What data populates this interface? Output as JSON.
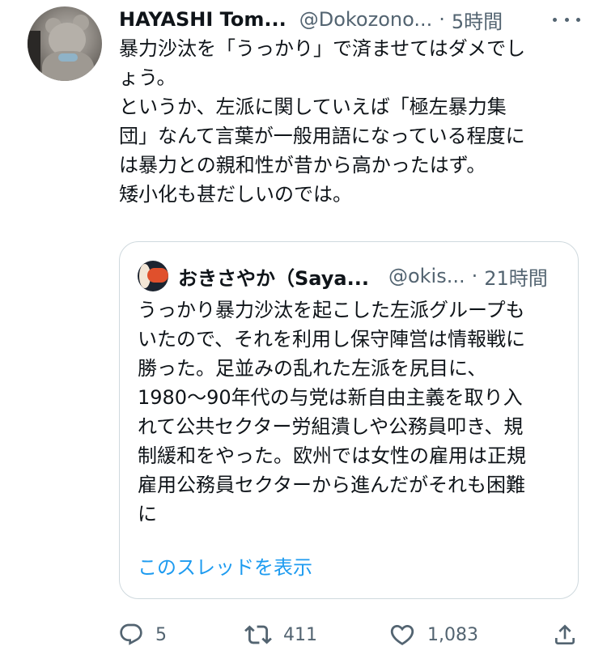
{
  "tweet": {
    "author_name": "HAYASHI Tom...",
    "author_handle": "@Dokozono...",
    "separator": "·",
    "time": "5時間",
    "lines": [
      "暴力沙汰を「うっかり」で済ませてはダメでし",
      "ょう。",
      "というか、左派に関していえば「極左暴力集",
      "団」なんて言葉が一般用語になっている程度に",
      "は暴力との親和性が昔から高かったはず。",
      "矮小化も甚だしいのでは。"
    ]
  },
  "quote": {
    "author_name": "おきさやか（Saya...",
    "author_handle": "@okis...",
    "separator": "·",
    "time": "21時間",
    "lines": [
      "うっかり暴力沙汰を起こした左派グループも",
      "いたので、それを利用し保守陣営は情報戦に",
      "勝った。足並みの乱れた左派を尻目に、",
      "1980〜90年代の与党は新自由主義を取り入",
      "れて公共セクター労組潰しや公務員叩き、規",
      "制緩和をやった。欧州では女性の雇用は正規",
      "雇用公務員セクターから進んだがそれも困難",
      "に"
    ],
    "show_thread": "このスレッドを表示"
  },
  "actions": {
    "reply_count": "5",
    "retweet_count": "411",
    "like_count": "1,083"
  },
  "icons": {
    "more": "more-icon",
    "reply": "reply-icon",
    "retweet": "retweet-icon",
    "like": "heart-icon",
    "share": "share-icon"
  },
  "colors": {
    "text": "#0f1419",
    "secondary": "#536471",
    "link": "#1d9bf0",
    "border": "#cfd9de"
  }
}
